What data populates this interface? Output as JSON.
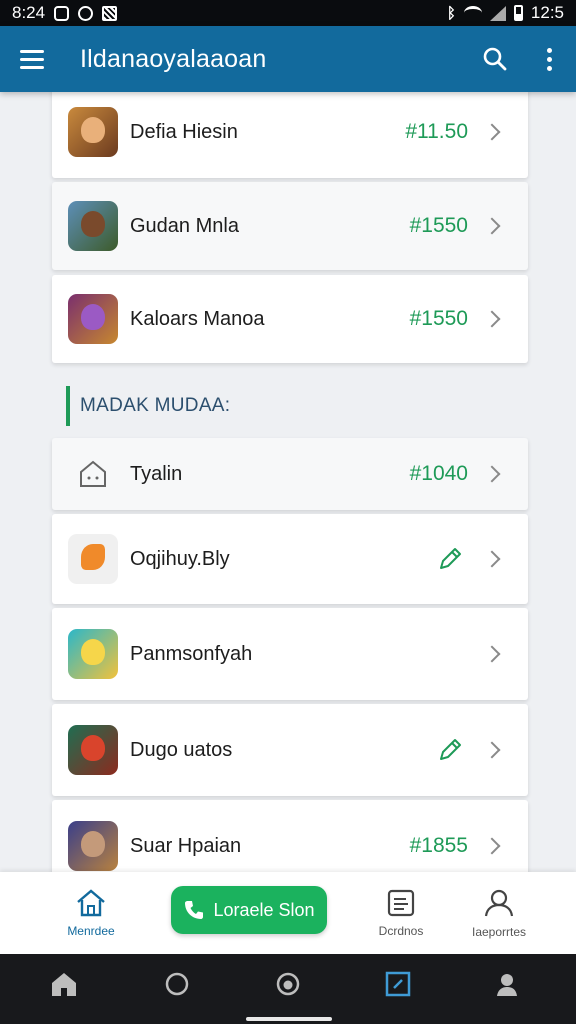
{
  "status_bar": {
    "time": "8:24",
    "clock_right": "12:5"
  },
  "app_bar": {
    "title": "Ildanaoyalaaoan",
    "menu_icon": "menu-icon",
    "search_icon": "search-icon",
    "more_icon": "more-vert-icon"
  },
  "top_items": [
    {
      "label": "Defia Hiesin",
      "price": "#11.50",
      "icon": "game-thumbnail"
    },
    {
      "label": "Gudan Mnla",
      "price": "#1550",
      "icon": "game-thumbnail"
    },
    {
      "label": "Kaloars Manoa",
      "price": "#1550",
      "icon": "game-thumbnail"
    }
  ],
  "section": {
    "title": "MADAK MUDAA:"
  },
  "section_items": [
    {
      "label": "Tyalin",
      "price": "#1040",
      "icon": "house-icon"
    },
    {
      "label": "Oqjihuy.Bly",
      "price": "",
      "icon": "edit-pencil-icon"
    },
    {
      "label": "Panmsonfyah",
      "price": "",
      "icon": ""
    },
    {
      "label": "Dugo uatos",
      "price": "",
      "icon": "edit-pencil-icon"
    },
    {
      "label": "Suar Hpaian",
      "price": "#1855",
      "icon": "game-thumbnail"
    }
  ],
  "bottom_nav": {
    "home_label": "Menrdee",
    "fab_label": "Loraele Slon",
    "docs_label": "Dcrdnos",
    "profile_label": "Iaeporrtes"
  },
  "colors": {
    "primary": "#126a9d",
    "accent": "#1e9a57",
    "fab": "#1bb25e"
  }
}
